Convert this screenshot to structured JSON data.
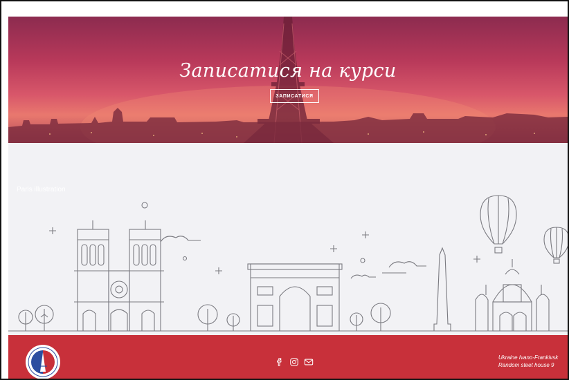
{
  "hero": {
    "title": "Записатися на курси",
    "button_label": "ЗАПИСАТИСЯ"
  },
  "illustration": {
    "caption": "Paris illustration"
  },
  "footer": {
    "address_line1": "Ukraine Ivano-Frankivsk",
    "address_line2": "Random steet house 9",
    "socials": [
      "facebook-icon",
      "instagram-icon",
      "mail-icon"
    ]
  },
  "colors": {
    "hero_top": "#8c2b4f",
    "hero_glow": "#e9786e",
    "illustration_bg": "#f2f2f5",
    "footer_bg": "#c8303a",
    "line_art": "#7a7a80"
  }
}
